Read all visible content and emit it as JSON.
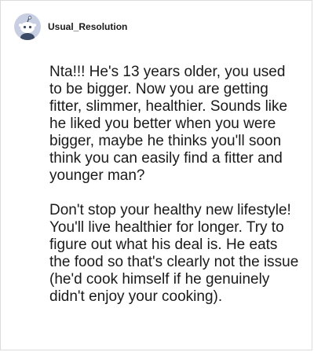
{
  "comment": {
    "username": "Usual_Resolution",
    "avatar_icon": "reddit-snoo-avatar-icon",
    "paragraphs": [
      "Nta!!! He's 13 years older, you used to be bigger. Now you are getting fitter, slimmer, healthier. Sounds like he liked you better when you were bigger, maybe he thinks you'll soon think you can easily find a fitter and younger man?",
      "Don't stop your healthy new lifestyle! You'll live healthier for longer. Try to figure out what his deal is. He eats the food so that's clearly not the issue (he'd cook himself if he genuinely didn't enjoy your cooking)."
    ]
  },
  "colors": {
    "avatar_bg": "#c9cfe3",
    "text": "#1a1a1b",
    "border": "#dcdcdc"
  }
}
